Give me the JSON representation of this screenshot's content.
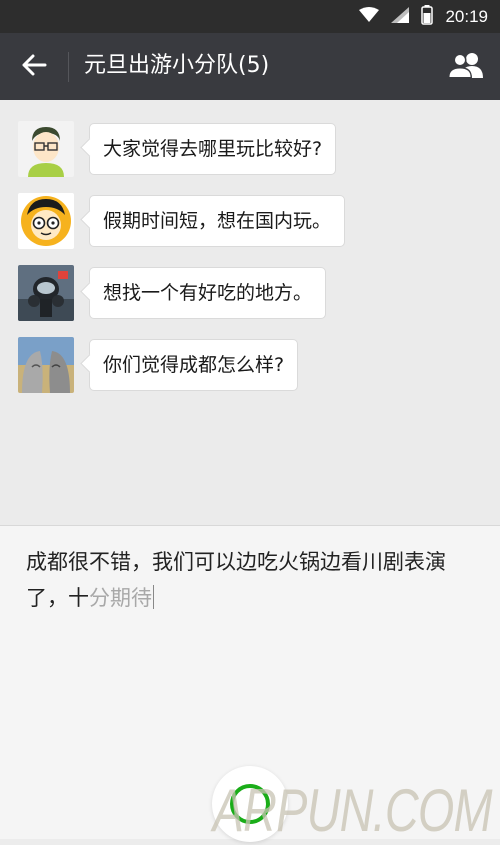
{
  "status_bar": {
    "time": "20:19",
    "icons": [
      "wifi-icon",
      "signal-icon",
      "battery-icon"
    ]
  },
  "header": {
    "title": "元旦出游小分队(5)",
    "back_icon": "back-arrow-icon",
    "members_icon": "group-members-icon"
  },
  "messages": [
    {
      "avatar": "avatar-cartoon-man-glasses",
      "text": "大家觉得去哪里玩比较好?"
    },
    {
      "avatar": "avatar-cartoon-yellow-face",
      "text": "假期时间短，想在国内玩。"
    },
    {
      "avatar": "avatar-scuba-diver",
      "text": "想找一个有好吃的地方。"
    },
    {
      "avatar": "avatar-metal-heads",
      "text": "你们觉得成都怎么样?"
    }
  ],
  "input": {
    "typed_text": "成都很不错，我们可以边吃火锅边看川剧表演了，十",
    "pending_text": "分期待"
  },
  "voice_button": {
    "icon": "mic-circle-icon"
  },
  "watermark": "ARPUN.COM",
  "colors": {
    "status_bar_bg": "#2d2d2d",
    "title_bar_bg": "#393a3f",
    "chat_bg": "#ebebeb",
    "bubble_bg": "#ffffff",
    "accent_green": "#1aad19"
  }
}
